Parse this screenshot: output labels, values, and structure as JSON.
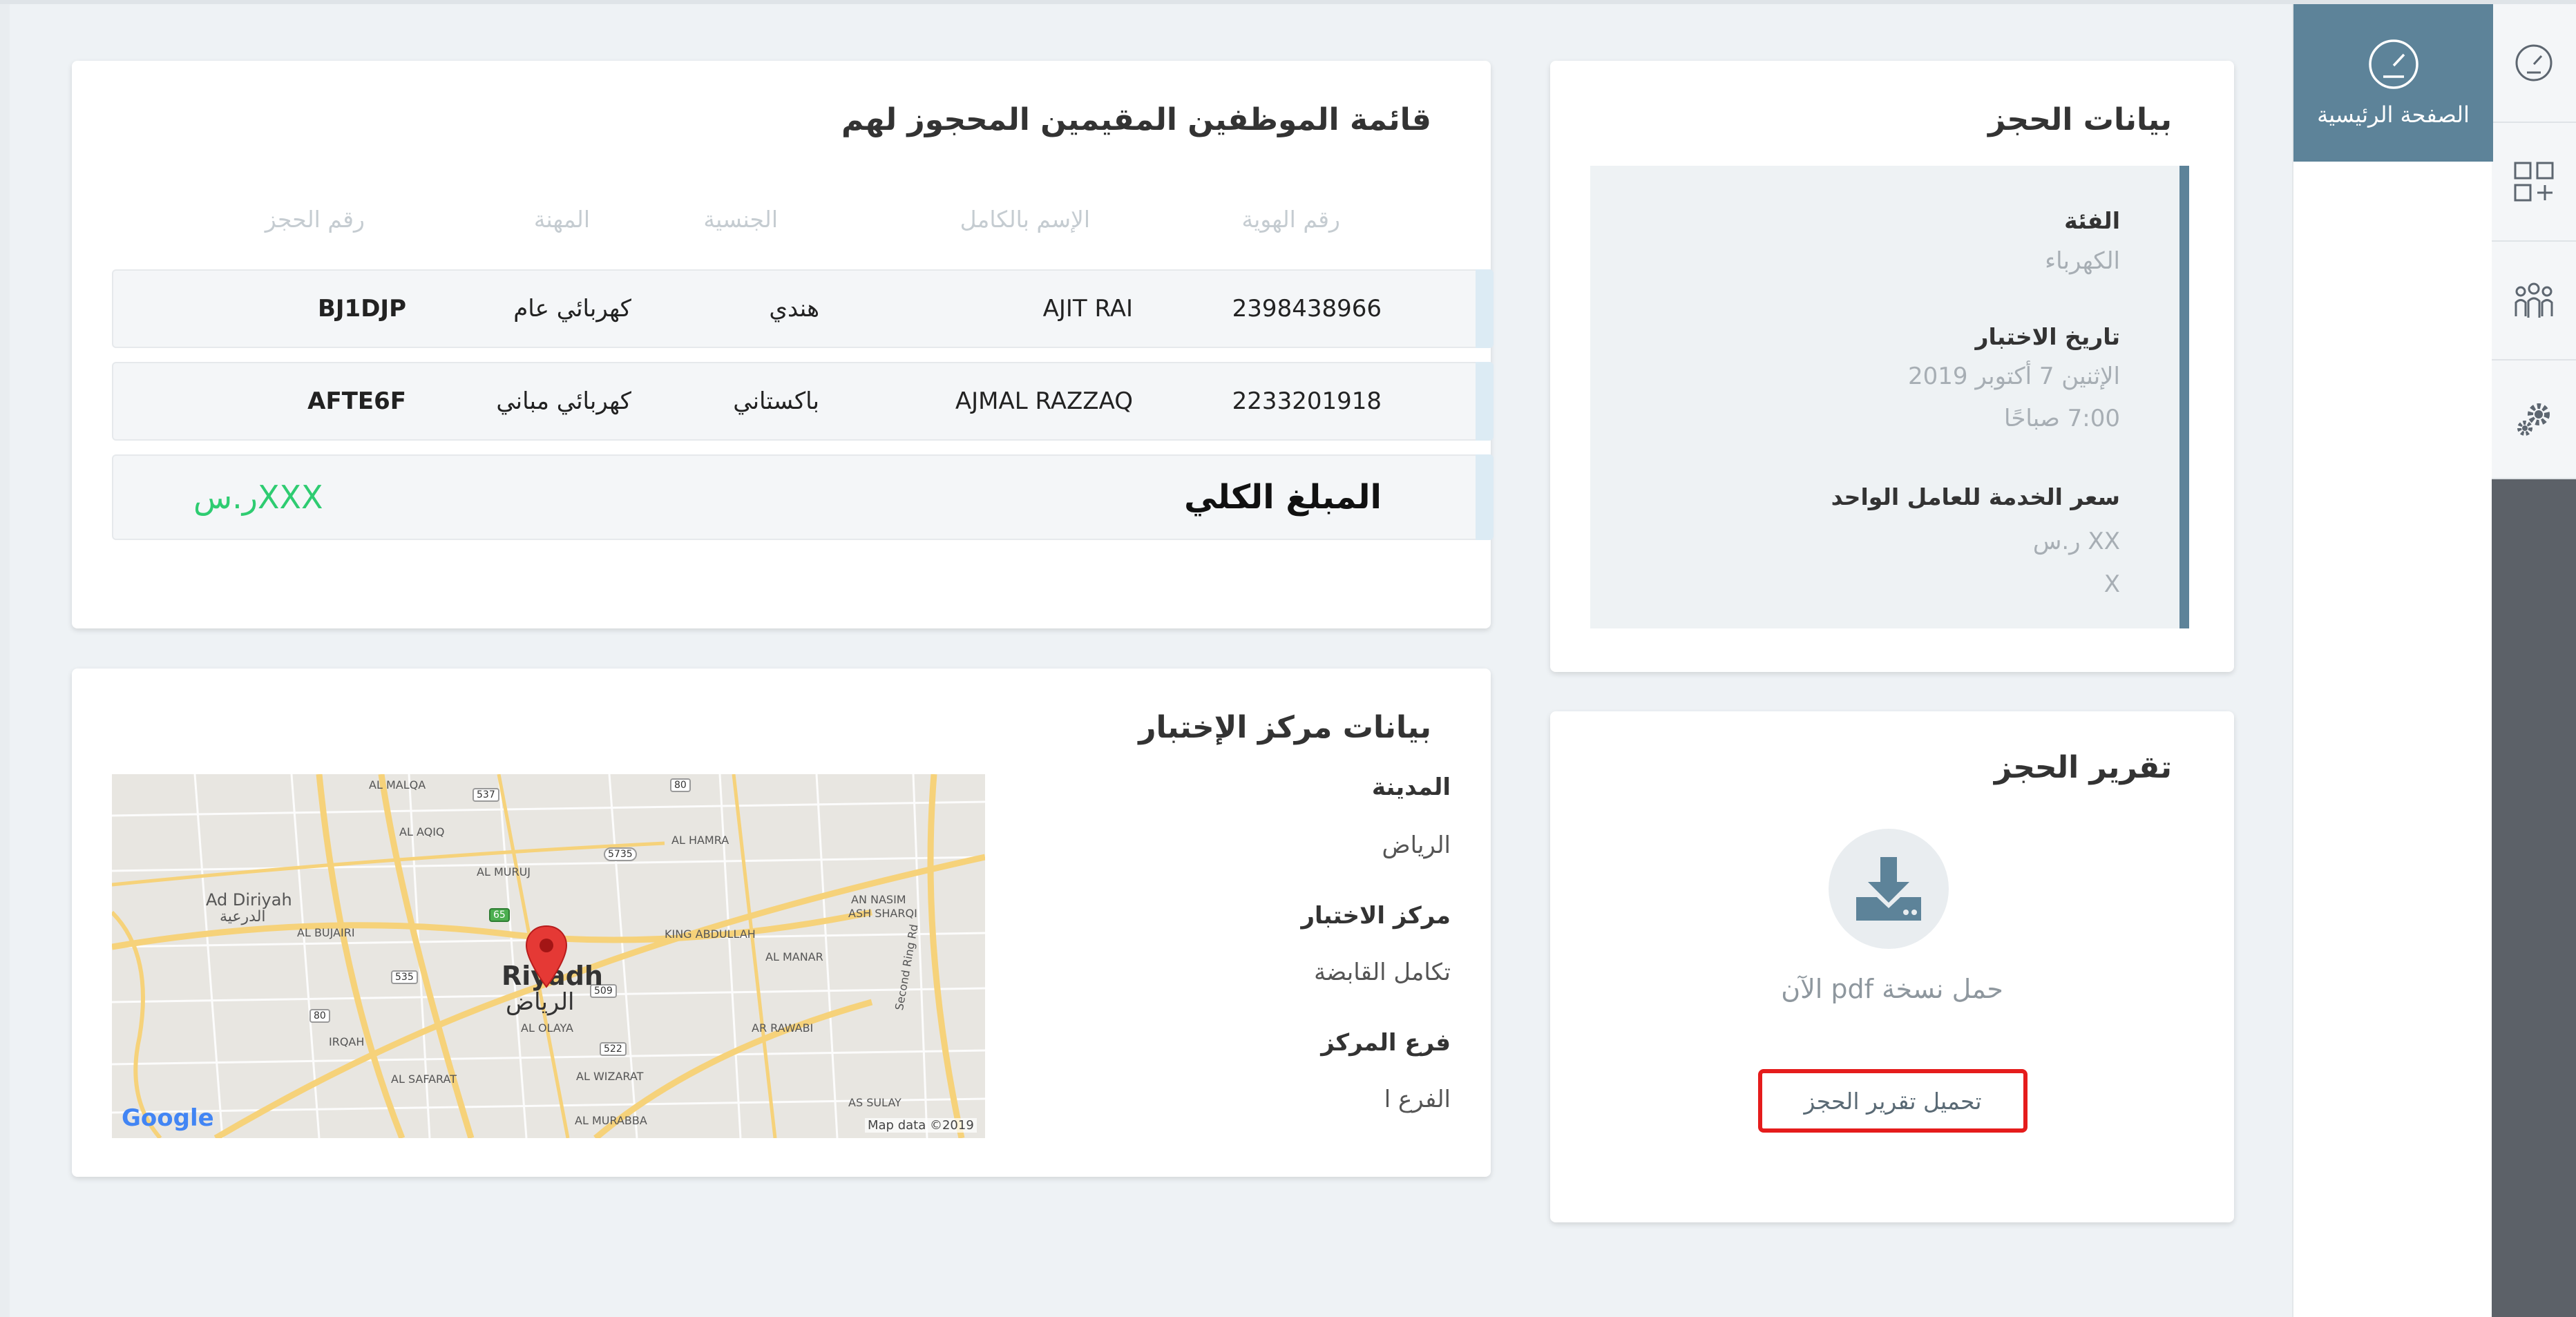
{
  "sidebar": {
    "home_label": "الصفحة الرئيسية",
    "rail_icons": [
      "speedometer-icon",
      "add-grid-icon",
      "people-icon",
      "gears-icon"
    ]
  },
  "booking_details": {
    "title": "بيانات الحجز",
    "category_label": "الفئة",
    "category_value": "الكهرباء",
    "test_date_label": "تاريخ الاختبار",
    "test_date_value": "الإثنين 7 أكتوبر 2019",
    "test_time_value": "7:00 صباحًا",
    "service_price_label": "سعر الخدمة للعامل الواحد",
    "service_price_value": "XX ر.س",
    "service_price_extra": "X"
  },
  "booking_report": {
    "title": "تقرير الحجز",
    "download_text": "حمل نسخة pdf الآن",
    "download_button": "تحميل تقرير الحجز"
  },
  "employees": {
    "title": "قائمة الموظفين المقيمين المحجوز لهم",
    "columns": {
      "id": "رقم الهوية",
      "name": "الإسم بالكامل",
      "nationality": "الجنسية",
      "profession": "المهنة",
      "booking_no": "رقم الحجز"
    },
    "rows": [
      {
        "id": "2398438966",
        "name": "AJIT RAI",
        "nationality": "هندي",
        "profession": "كهربائي عام",
        "booking_no": "BJ1DJP"
      },
      {
        "id": "2233201918",
        "name": "AJMAL RAZZAQ",
        "nationality": "باكستاني",
        "profession": "كهربائي مباني",
        "booking_no": "AFTE6F"
      }
    ],
    "total_label": "المبلغ الكلي",
    "total_value": "XXXر.س"
  },
  "test_center": {
    "title": "بيانات مركز الإختبار",
    "city_label": "المدينة",
    "city_value": "الرياض",
    "center_label": "مركز الاختبار",
    "center_value": "تكامل القابضة",
    "branch_label": "فرع المركز",
    "branch_value": "الفرع ا"
  },
  "map": {
    "city_en": "Riyadh",
    "city_ar": "الرياض",
    "labels": [
      "AL MALQA",
      "AL AQIQ",
      "AL MURUJ",
      "AL HAMRA",
      "AN NASIM",
      "ASH SHARQI",
      "KING ABDULLAH",
      "AL MANAR",
      "Ad Diriyah",
      "الدرعية",
      "AL BUJAIRI",
      "AL OLAYA",
      "IRQAH",
      "AR RAWABI",
      "AL SAFARAT",
      "AL WIZARAT",
      "AL MURABBA",
      "AS SULAY",
      "Second Ring Rd"
    ],
    "shields": [
      "537",
      "80",
      "5735",
      "65",
      "535",
      "509",
      "80",
      "522"
    ],
    "google": "Google",
    "attribution": "Map data ©2019"
  }
}
